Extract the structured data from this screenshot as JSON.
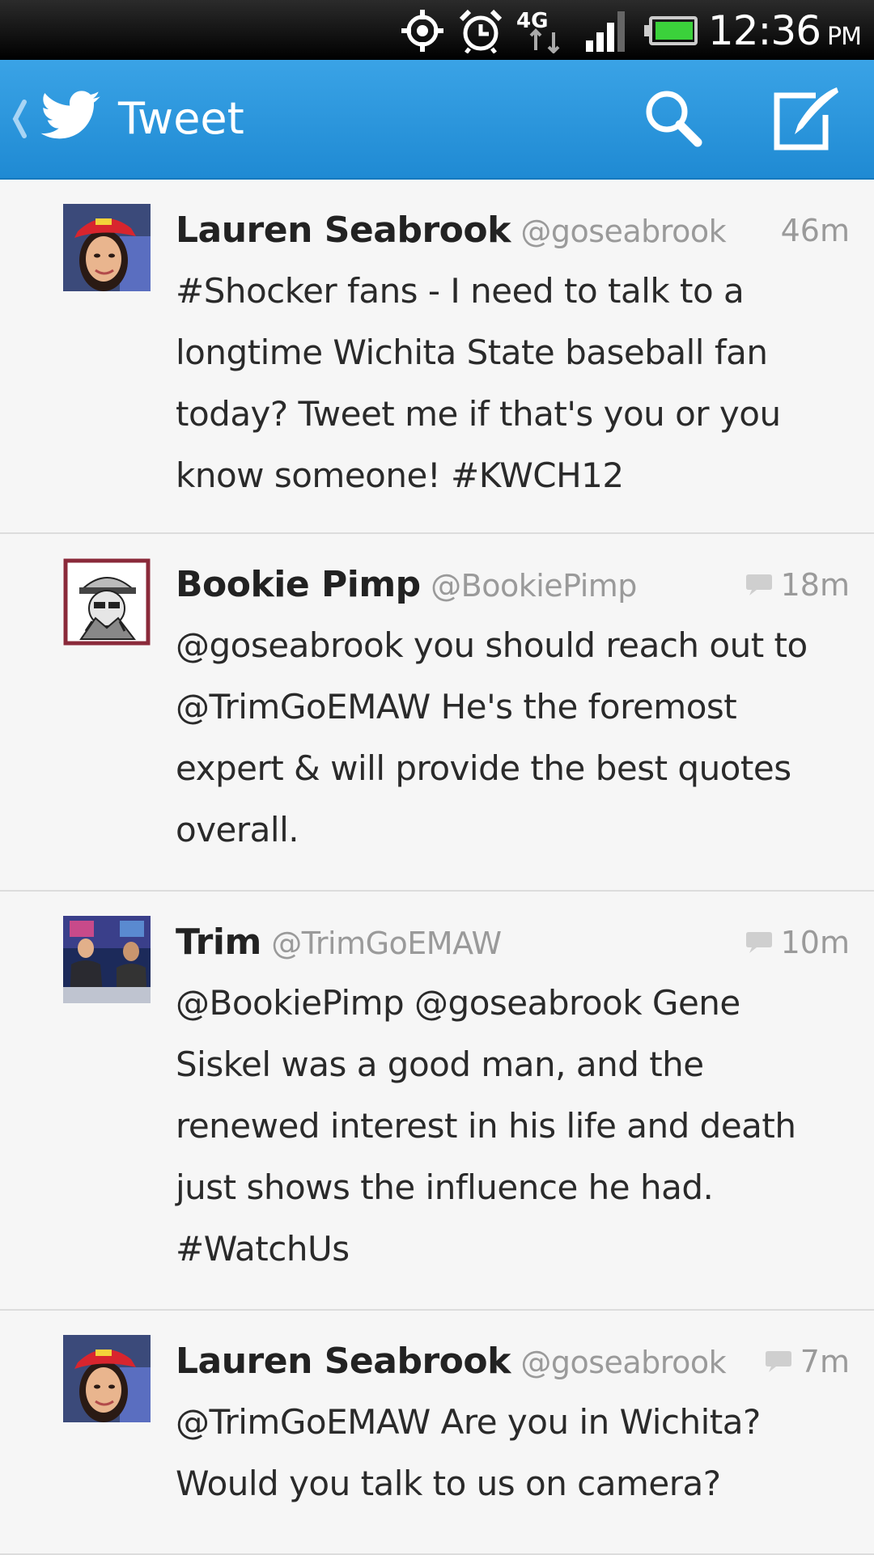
{
  "status_bar": {
    "time": "12:36",
    "ampm": "PM",
    "network": "4G",
    "icons": [
      "gps-icon",
      "alarm-icon",
      "4g-lte-icon",
      "signal-icon",
      "battery-icon"
    ]
  },
  "action_bar": {
    "title": "Tweet",
    "color": "#2b96dc",
    "icons": [
      "back-chevron-icon",
      "twitter-bird-icon",
      "search-icon",
      "compose-icon"
    ]
  },
  "tweets": [
    {
      "name": "Lauren Seabrook",
      "handle": "@goseabrook",
      "time": "46m",
      "reply_indicator": false,
      "text": "#Shocker fans - I need to talk to a\nlongtime Wichita State baseball fan\ntoday? Tweet me if that's you or you\nknow someone! #KWCH12"
    },
    {
      "name": "Bookie Pimp",
      "handle": "@BookiePimp",
      "time": "18m",
      "reply_indicator": true,
      "text": "@goseabrook you should reach out to\n@TrimGoEMAW  He's the foremost\nexpert & will provide the best quotes\noverall."
    },
    {
      "name": "Trim",
      "handle": "@TrimGoEMAW",
      "time": "10m",
      "reply_indicator": true,
      "text": "@BookiePimp @goseabrook Gene\nSiskel was a good man, and the\nrenewed interest in his life and death\njust shows the influence he had.\n#WatchUs"
    },
    {
      "name": "Lauren Seabrook",
      "handle": "@goseabrook",
      "time": "7m",
      "reply_indicator": true,
      "text": "@TrimGoEMAW Are you in Wichita?\nWould you talk to us on camera?"
    }
  ]
}
